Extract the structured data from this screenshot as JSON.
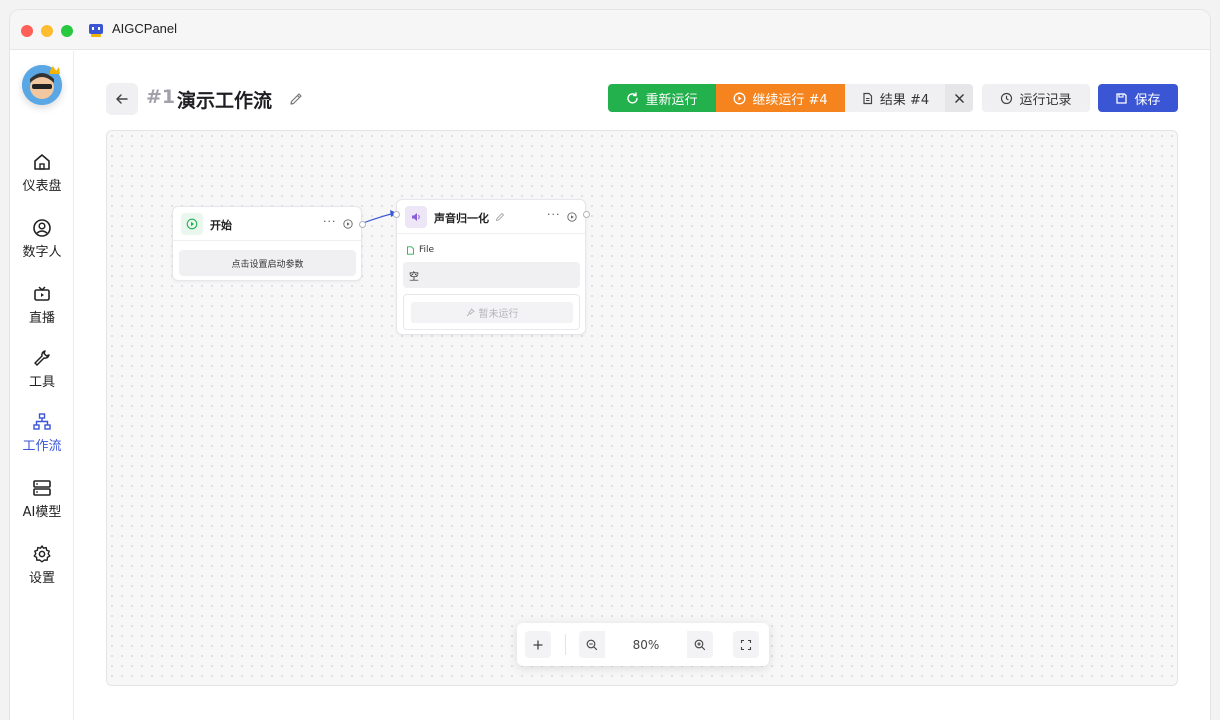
{
  "app": {
    "title": "AIGCPanel"
  },
  "sidebar": {
    "items": [
      {
        "label": "仪表盘",
        "icon": "home-icon"
      },
      {
        "label": "数字人",
        "icon": "user-circle-icon"
      },
      {
        "label": "直播",
        "icon": "tv-icon"
      },
      {
        "label": "工具",
        "icon": "wrench-icon"
      },
      {
        "label": "工作流",
        "icon": "workflow-icon",
        "active": true
      },
      {
        "label": "AI模型",
        "icon": "server-icon"
      },
      {
        "label": "设置",
        "icon": "gear-icon"
      }
    ]
  },
  "header": {
    "number": "#1",
    "title": "演示工作流",
    "rerun": "重新运行",
    "continue_run": "继续运行 #4",
    "result": "结果 #4",
    "history": "运行记录",
    "save": "保存"
  },
  "nodes": {
    "start": {
      "title": "开始",
      "more": "···",
      "param_button": "点击设置启动参数"
    },
    "normalize": {
      "title": "声音归一化",
      "more": "···",
      "field_label": "File",
      "field_value": "空",
      "run_status": "暂未运行"
    }
  },
  "zoom": {
    "value": "80%"
  },
  "colors": {
    "accent": "#3a56d4",
    "rerun": "#22b14c",
    "continue": "#f5841f"
  }
}
